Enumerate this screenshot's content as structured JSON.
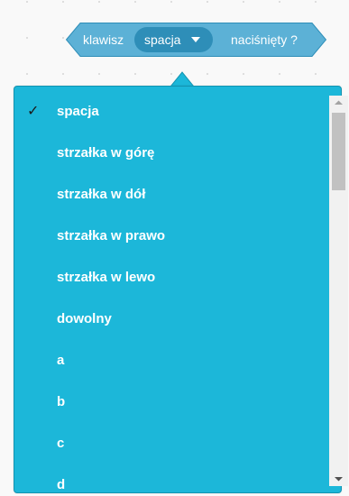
{
  "block": {
    "label_before": "klawisz",
    "selected_key": "spacja",
    "label_after": "naciśnięty ?",
    "colors": {
      "block_fill": "#5cb1d6",
      "block_stroke": "#2e8eb8",
      "menu_fill": "#2e8eb8"
    }
  },
  "dropdown": {
    "background": "#1cb7d9",
    "check_mark": "✓",
    "options": [
      {
        "label": "spacja",
        "selected": true
      },
      {
        "label": "strzałka w górę",
        "selected": false
      },
      {
        "label": "strzałka w dół",
        "selected": false
      },
      {
        "label": "strzałka w prawo",
        "selected": false
      },
      {
        "label": "strzałka w lewo",
        "selected": false
      },
      {
        "label": "dowolny",
        "selected": false
      },
      {
        "label": "a",
        "selected": false
      },
      {
        "label": "b",
        "selected": false
      },
      {
        "label": "c",
        "selected": false
      },
      {
        "label": "d",
        "selected": false
      }
    ],
    "scroll_fraction": 0.0
  }
}
